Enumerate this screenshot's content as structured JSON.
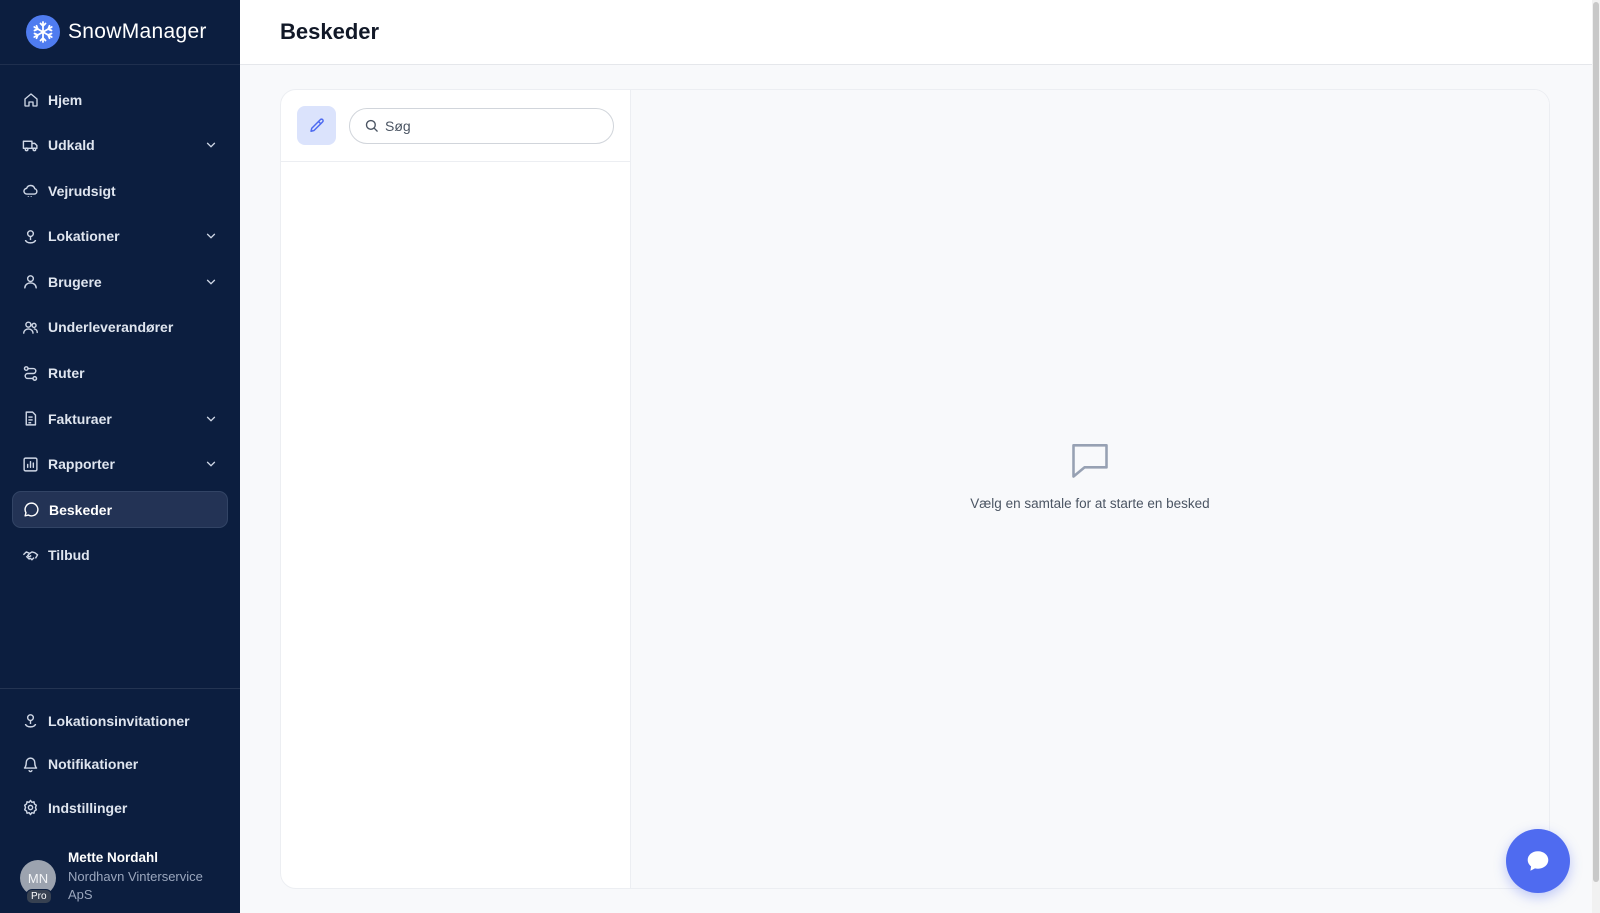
{
  "brand": {
    "name": "SnowManager",
    "icon": "snowflake-icon"
  },
  "page": {
    "title": "Beskeder"
  },
  "nav": {
    "items": [
      {
        "label": "Hjem",
        "icon": "home-icon",
        "expandable": false
      },
      {
        "label": "Udkald",
        "icon": "truck-icon",
        "expandable": true
      },
      {
        "label": "Vejrudsigt",
        "icon": "cloud-icon",
        "expandable": false
      },
      {
        "label": "Lokationer",
        "icon": "location-pin-icon",
        "expandable": true
      },
      {
        "label": "Brugere",
        "icon": "user-icon",
        "expandable": true
      },
      {
        "label": "Underleverandører",
        "icon": "users-icon",
        "expandable": false
      },
      {
        "label": "Ruter",
        "icon": "route-icon",
        "expandable": false
      },
      {
        "label": "Fakturaer",
        "icon": "document-icon",
        "expandable": true
      },
      {
        "label": "Rapporter",
        "icon": "bar-chart-icon",
        "expandable": true
      },
      {
        "label": "Beskeder",
        "icon": "message-icon",
        "expandable": false,
        "active": true
      },
      {
        "label": "Tilbud",
        "icon": "handshake-icon",
        "expandable": false
      }
    ]
  },
  "bottom_nav": {
    "items": [
      {
        "label": "Lokationsinvitationer",
        "icon": "location-pin-icon"
      },
      {
        "label": "Notifikationer",
        "icon": "bell-icon"
      },
      {
        "label": "Indstillinger",
        "icon": "gear-icon"
      }
    ]
  },
  "user": {
    "initials": "MN",
    "badge": "Pro",
    "name": "Mette Nordahl",
    "company": "Nordhavn Vinterservice ApS"
  },
  "messages": {
    "search_placeholder": "Søg",
    "empty_state": "Vælg en samtale for at starte en besked"
  },
  "colors": {
    "sidebar_bg": "#0c1e3f",
    "accent": "#4f6bf0",
    "compose_bg": "#dbe3fc"
  }
}
